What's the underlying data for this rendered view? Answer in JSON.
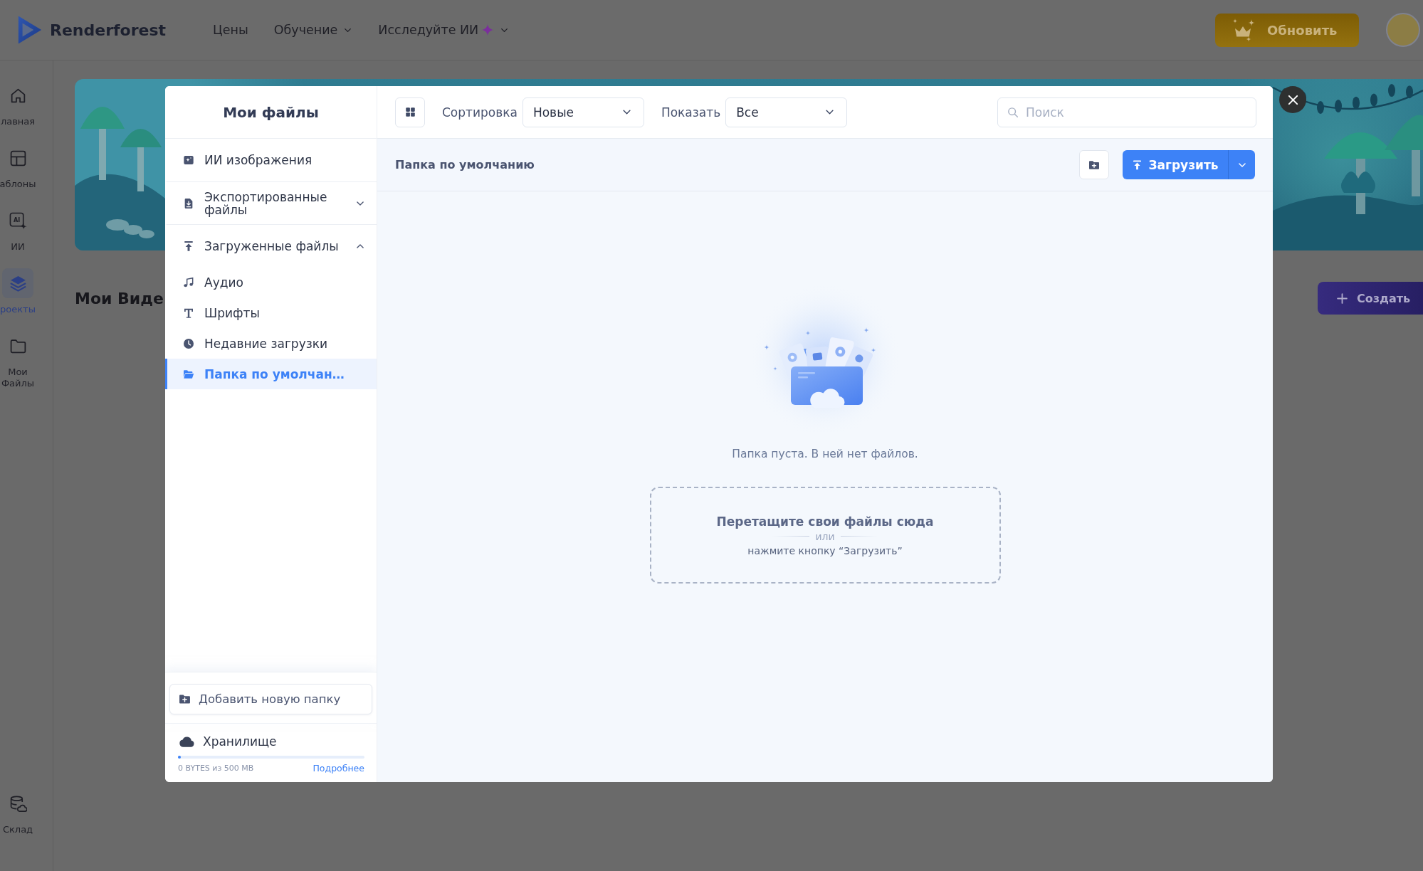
{
  "top_bar": {
    "logo": "Renderforest",
    "nav": [
      {
        "label": "Цены",
        "kind": "plain"
      },
      {
        "label": "Обучение",
        "kind": "menu"
      },
      {
        "label": "Исследуйте ИИ",
        "kind": "ai"
      }
    ],
    "upgrade_button": "Обновить"
  },
  "side_nav": {
    "items": [
      {
        "label": "лавная",
        "selected": false
      },
      {
        "label": "аблоны",
        "selected": false
      },
      {
        "label": "ИИ",
        "icon_text": "AI",
        "selected": false
      },
      {
        "label": "роекты",
        "selected": true
      },
      {
        "label": "Мои Файлы",
        "selected": false
      }
    ],
    "bottom_item": {
      "label": "Склад",
      "selected": false
    }
  },
  "page": {
    "heading": "Мои Виде",
    "create_button": "Создать"
  },
  "modal": {
    "title": "Мои файлы",
    "folders": [
      {
        "label": "ИИ изображения",
        "selected": false
      },
      {
        "label": "Экспортированные файлы",
        "selected": false,
        "expanded": false
      },
      {
        "label": "Загруженные файлы",
        "selected": false,
        "expanded": true,
        "children": [
          {
            "label": "Аудио",
            "selected": false
          },
          {
            "label": "Шрифты",
            "selected": false
          },
          {
            "label": "Недавние загрузки",
            "selected": false
          },
          {
            "label": "Папка по умолчан…",
            "selected": true
          }
        ]
      }
    ],
    "add_folder_button": "Добавить новую папку",
    "storage": {
      "label": "Хранилище",
      "level": 0,
      "usage": "0 BYTES из 500 MB",
      "details_link": "Подробнее"
    },
    "toolbar": {
      "sort_label": "Сортировка",
      "sort_value": "Новые",
      "show_label": "Показать",
      "show_value": "Все",
      "search": {
        "placeholder": "Поиск"
      }
    },
    "folder_bar": {
      "title": "Папка по умолчанию",
      "upload_button": "Загрузить"
    },
    "empty_state": {
      "message": "Папка пуста. В ней нет файлов.",
      "drop_title": "Перетащите свои файлы сюда",
      "separator": "или",
      "drop_hint": "нажмите кнопку “Загрузить”"
    }
  }
}
